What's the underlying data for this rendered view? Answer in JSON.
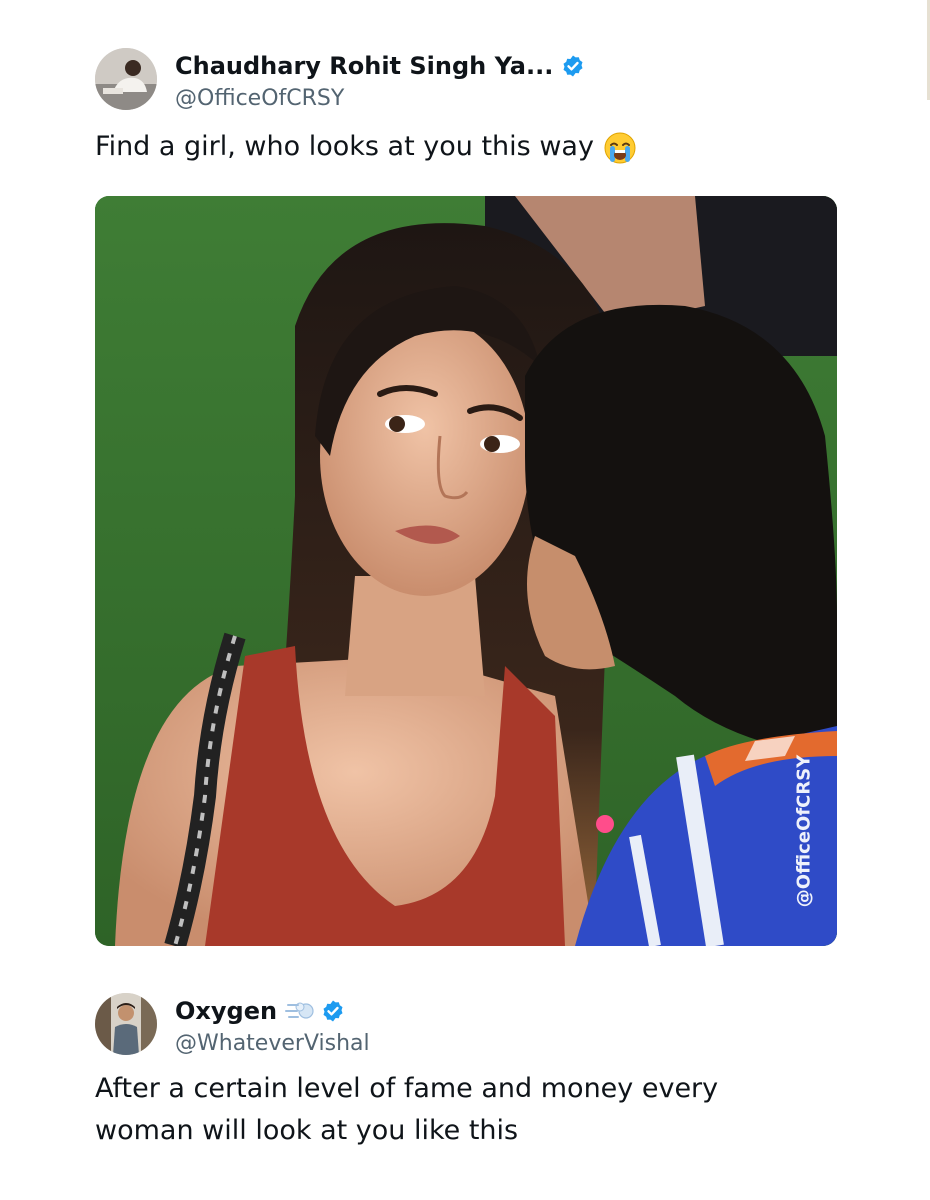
{
  "tweets": [
    {
      "display_name": "Chaudhary Rohit Singh Ya...",
      "handle": "@OfficeOfCRSY",
      "verified": true,
      "text": "Find a girl, who looks at you this way",
      "text_emoji": "loudly-crying-face",
      "media": {
        "description_icon": "photo",
        "watermark": "@OfficeOfCRSY"
      }
    },
    {
      "display_name": "Oxygen",
      "name_emoji": "dashing-away",
      "handle": "@WhateverVishal",
      "verified": true,
      "text": "After a certain level of fame and money every woman will look at you like this"
    }
  ],
  "colors": {
    "verified_blue": "#1d9bf0",
    "text_primary": "#0f1419",
    "text_secondary": "#536471"
  }
}
